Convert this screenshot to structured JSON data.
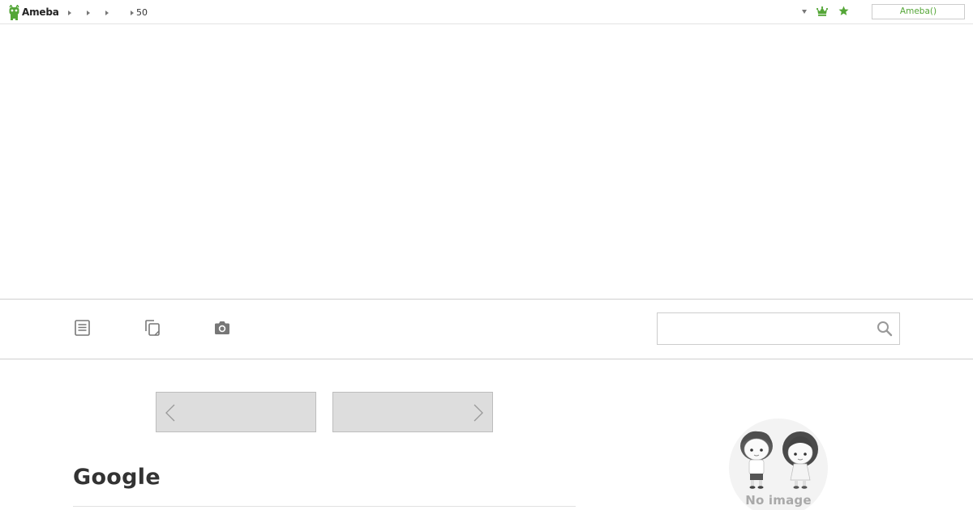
{
  "header": {
    "logo_text": "Ameba",
    "breadcrumbs": [
      "",
      "",
      "",
      "50"
    ],
    "ameba_button_label": "Ameba()",
    "accent_color": "#54a637"
  },
  "nav": {
    "items": [
      {
        "icon": "entry-list-icon"
      },
      {
        "icon": "copy-pages-icon"
      },
      {
        "icon": "camera-icon"
      }
    ],
    "search": {
      "placeholder": "",
      "value": ""
    }
  },
  "pager": {
    "prev_label": "",
    "next_label": ""
  },
  "entry": {
    "title": "Google"
  },
  "profile": {
    "no_image_text": "No image"
  }
}
